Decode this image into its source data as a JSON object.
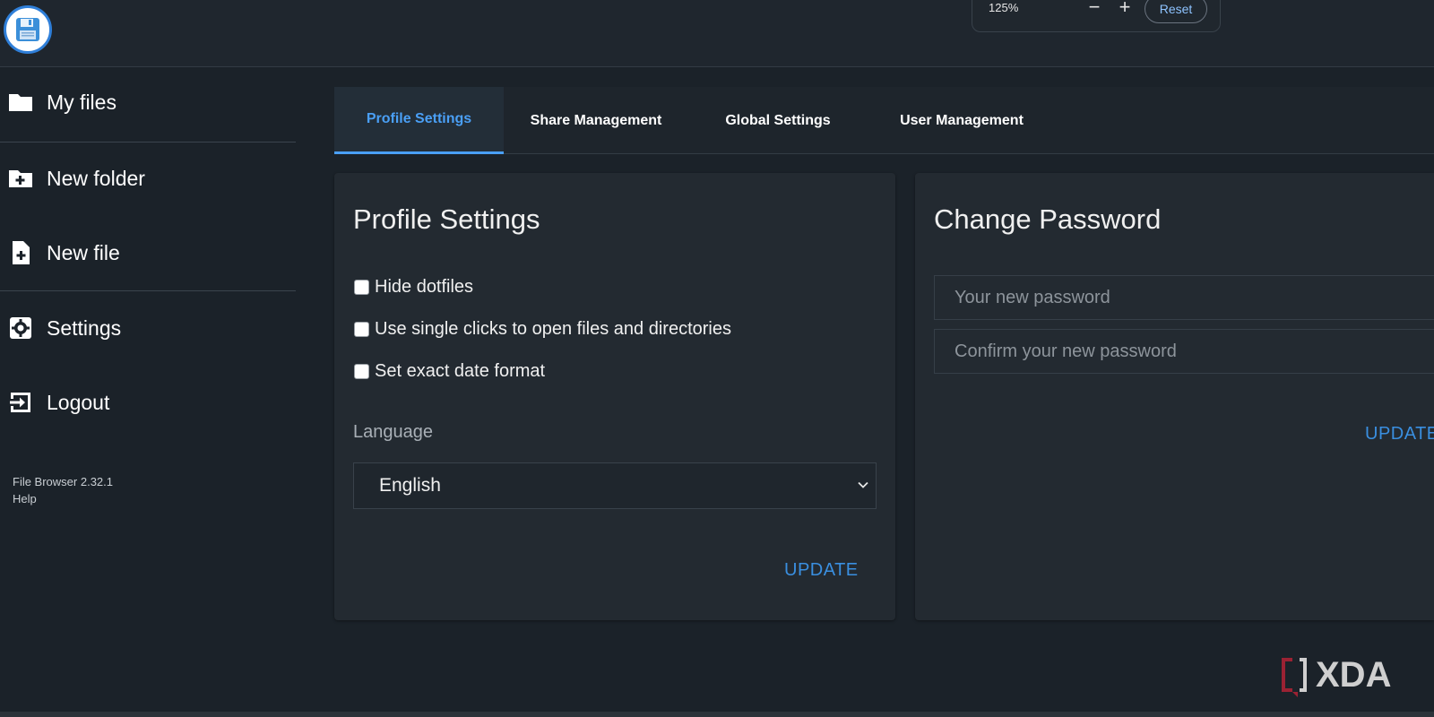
{
  "header": {
    "logo_alt": "File Browser logo"
  },
  "zoom": {
    "level": "125%",
    "minus": "−",
    "plus": "+",
    "reset": "Reset"
  },
  "sidebar": {
    "items": [
      {
        "label": "My files",
        "icon": "folder-icon"
      },
      {
        "label": "New folder",
        "icon": "folder-plus-icon"
      },
      {
        "label": "New file",
        "icon": "file-plus-icon"
      },
      {
        "label": "Settings",
        "icon": "gear-icon"
      },
      {
        "label": "Logout",
        "icon": "logout-icon"
      }
    ],
    "version": "File Browser 2.32.1",
    "help": "Help"
  },
  "tabs": [
    {
      "label": "Profile Settings",
      "active": true
    },
    {
      "label": "Share Management",
      "active": false
    },
    {
      "label": "Global Settings",
      "active": false
    },
    {
      "label": "User Management",
      "active": false
    }
  ],
  "profile": {
    "title": "Profile Settings",
    "checkboxes": [
      {
        "label": "Hide dotfiles",
        "checked": false
      },
      {
        "label": "Use single clicks to open files and directories",
        "checked": false
      },
      {
        "label": "Set exact date format",
        "checked": false
      }
    ],
    "language_label": "Language",
    "language_value": "English",
    "update_label": "UPDATE"
  },
  "password": {
    "title": "Change Password",
    "new_placeholder": "Your new password",
    "confirm_placeholder": "Confirm your new password",
    "update_label": "UPDATE"
  },
  "colors": {
    "accent": "#4a9ff5",
    "background": "#1b2229",
    "card": "#232a31"
  },
  "watermark": "XDA"
}
